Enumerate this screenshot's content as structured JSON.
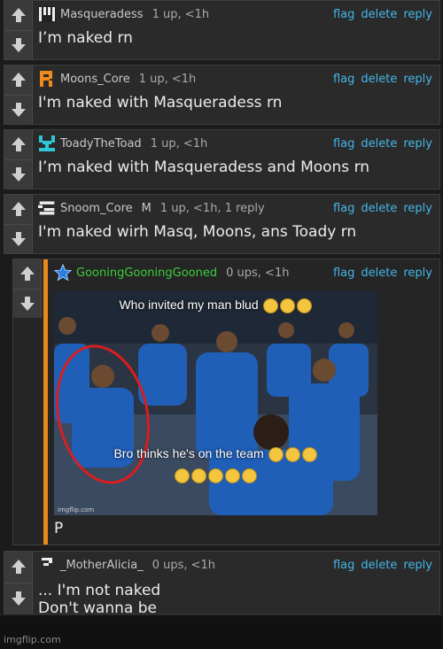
{
  "comments": [
    {
      "username": "Masqueradess",
      "mod": "",
      "meta": "1 up, <1h",
      "text": "I’m naked rn"
    },
    {
      "username": "Moons_Core",
      "mod": "",
      "meta": "1 up, <1h",
      "text": "I'm naked with Masqueradess rn"
    },
    {
      "username": "ToadyTheToad",
      "mod": "",
      "meta": "1 up, <1h",
      "text": "I’m naked with Masqueradess and Moons rn"
    },
    {
      "username": "Snoom_Core",
      "mod": "M",
      "meta": "1 up, <1h, 1 reply",
      "text": "I'm naked wirh Masq, Moons, ans Toady rn"
    },
    {
      "username": "GooningGooningGooned",
      "mod": "",
      "meta": "0 ups, <1h",
      "text": "P",
      "meme": {
        "top_caption": "Who invited my man blud",
        "bottom_caption": "Bro thinks he's on the team",
        "watermark": "imgflip.com"
      }
    },
    {
      "username": "_MotherAlicia_",
      "mod": "",
      "meta": "0 ups, <1h",
      "text_line1": "... I'm not naked",
      "text_line2": "Don't wanna be"
    }
  ],
  "actions": {
    "flag": "flag",
    "delete": "delete",
    "reply": "reply"
  },
  "footer": {
    "watermark": "imgflip.com"
  },
  "colors": {
    "link": "#44b6e8",
    "reply_stripe": "#e88a1a",
    "username_green": "#3ccf3c",
    "avatar_orange": "#f08a1a",
    "avatar_cyan": "#2fc7d8"
  },
  "icons": [
    "up-arrow-icon",
    "down-arrow-icon",
    "star-icon"
  ]
}
